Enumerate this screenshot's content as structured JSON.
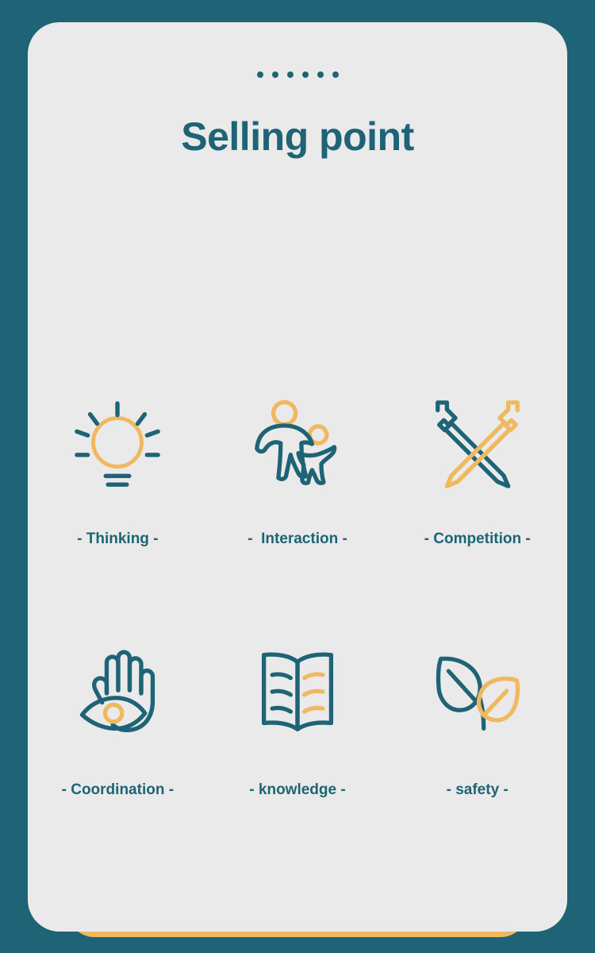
{
  "theme": {
    "background": "#1e6476",
    "card_background": "#eaeaea",
    "teal": "#1e6476",
    "gold": "#f0b95f"
  },
  "header": {
    "dots_count": 6,
    "title": "Selling point"
  },
  "features": [
    {
      "icon": "lightbulb-icon",
      "label": "- Thinking -"
    },
    {
      "icon": "two-people-icon",
      "label": "-  Interaction -"
    },
    {
      "icon": "crossed-swords-icon",
      "label": "- Competition -"
    },
    {
      "icon": "hand-eye-icon",
      "label": "- Coordination -"
    },
    {
      "icon": "open-book-icon",
      "label": "- knowledge -"
    },
    {
      "icon": "leaves-icon",
      "label": "- safety -"
    }
  ]
}
